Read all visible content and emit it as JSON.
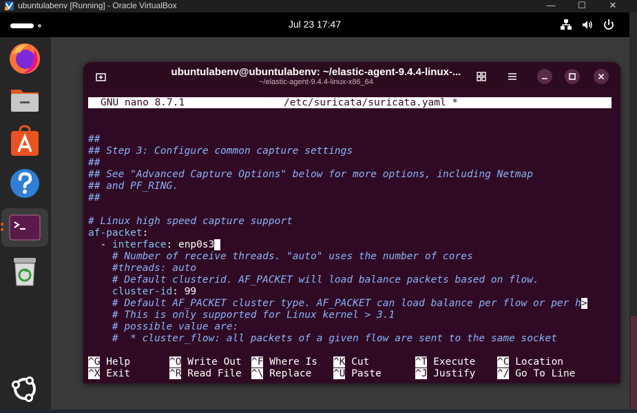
{
  "vbox": {
    "title": "ubuntulabenv [Running] - Oracle VirtualBox",
    "min_glyph": "—",
    "max_glyph": "☐",
    "close_glyph": "✕"
  },
  "topbar": {
    "clock": "Jul 23  17:47"
  },
  "dock": {
    "items": [
      {
        "icon": "firefox-icon"
      },
      {
        "icon": "files-icon"
      },
      {
        "icon": "app-center-icon"
      },
      {
        "icon": "help-icon"
      },
      {
        "icon": "terminal-icon"
      },
      {
        "icon": "trash-icon"
      },
      {
        "icon": "show-apps-icon"
      }
    ]
  },
  "terminal": {
    "title": "ubuntulabenv@ubuntulabenv: ~/elastic-agent-9.4.4-linux-...",
    "subtitle": "~/elastic-agent-9.4.4-linux-x86_64",
    "nano_version": "GNU nano 8.7.1",
    "file_name": "/etc/suricata/suricata.yaml *",
    "lines": [
      {
        "type": "comment",
        "text": "##"
      },
      {
        "type": "comment",
        "text": "## Step 3: Configure common capture settings"
      },
      {
        "type": "comment",
        "text": "##"
      },
      {
        "type": "comment",
        "text": "## See \"Advanced Capture Options\" below for more options, including Netmap"
      },
      {
        "type": "comment",
        "text": "## and PF_RING."
      },
      {
        "type": "comment",
        "text": "##"
      },
      {
        "type": "blank",
        "text": ""
      },
      {
        "type": "comment",
        "text": "# Linux high speed capture support"
      },
      {
        "type": "key",
        "key": "af-packet",
        "rest": ":"
      },
      {
        "type": "iface",
        "indent": "  - ",
        "key": "interface",
        "sep": ": ",
        "value": "enp0s3"
      },
      {
        "type": "comment",
        "text": "    # Number of receive threads. \"auto\" uses the number of cores"
      },
      {
        "type": "comment",
        "text": "    #threads: auto"
      },
      {
        "type": "comment",
        "text": "    # Default clusterid. AF_PACKET will load balance packets based on flow."
      },
      {
        "type": "keyval",
        "indent": "    ",
        "key": "cluster-id",
        "sep": ": ",
        "value": "99"
      },
      {
        "type": "overflow",
        "text": "    # Default AF_PACKET cluster type. AF_PACKET can load balance per flow or per h",
        "marker": ">"
      },
      {
        "type": "comment",
        "text": "    # This is only supported for Linux kernel > 3.1"
      },
      {
        "type": "comment",
        "text": "    # possible value are:"
      },
      {
        "type": "comment",
        "text": "    #  * cluster_flow: all packets of a given flow are sent to the same socket"
      }
    ],
    "shortcuts_row1": [
      {
        "key": "^G",
        "label": "Help"
      },
      {
        "key": "^O",
        "label": "Write Out"
      },
      {
        "key": "^F",
        "label": "Where Is"
      },
      {
        "key": "^K",
        "label": "Cut"
      },
      {
        "key": "^T",
        "label": "Execute"
      },
      {
        "key": "^C",
        "label": "Location"
      }
    ],
    "shortcuts_row2": [
      {
        "key": "^X",
        "label": "Exit"
      },
      {
        "key": "^R",
        "label": "Read File"
      },
      {
        "key": "^\\",
        "label": "Replace"
      },
      {
        "key": "^U",
        "label": "Paste"
      },
      {
        "key": "^J",
        "label": "Justify"
      },
      {
        "key": "^/",
        "label": "Go To Line"
      }
    ]
  },
  "colors": {
    "terminal_bg": "#300a24",
    "comment": "#8ab4f8",
    "key": "#7ec3f2",
    "accent": "#e95420"
  }
}
